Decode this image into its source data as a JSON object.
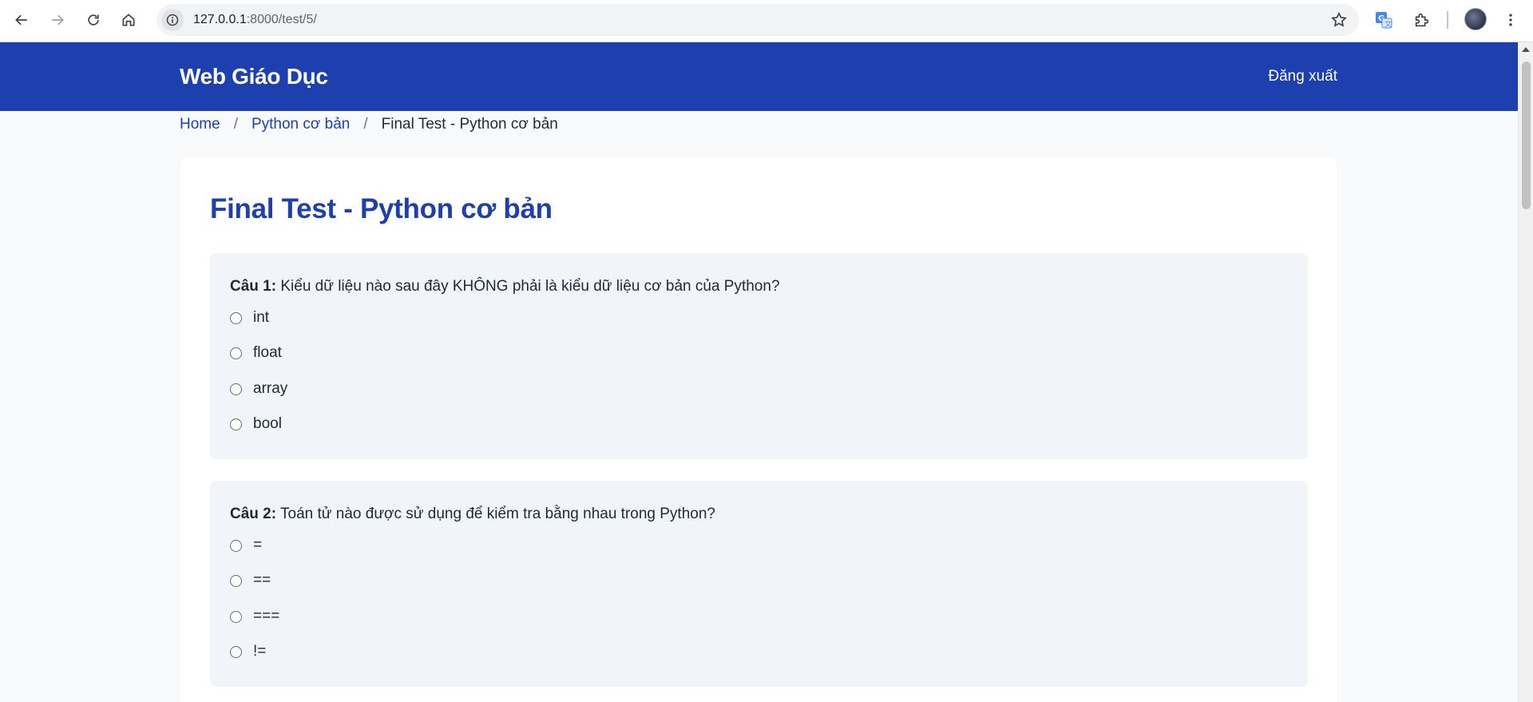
{
  "browser": {
    "url_host": "127.0.0.1",
    "url_rest": ":8000/test/5/"
  },
  "header": {
    "brand": "Web Giáo Dục",
    "logout": "Đăng xuất"
  },
  "breadcrumb": {
    "home": "Home",
    "course": "Python cơ bản",
    "current": "Final Test - Python cơ bản",
    "separator": "/"
  },
  "test": {
    "title": "Final Test - Python cơ bản",
    "questions": [
      {
        "label": "Câu 1:",
        "text": " Kiểu dữ liệu nào sau đây KHÔNG phải là kiểu dữ liệu cơ bản của Python?",
        "options": [
          "int",
          "float",
          "array",
          "bool"
        ]
      },
      {
        "label": "Câu 2:",
        "text": " Toán tử nào được sử dụng để kiểm tra bằng nhau trong Python?",
        "options": [
          "=",
          "==",
          "===",
          "!="
        ]
      }
    ]
  },
  "colors": {
    "primary": "#1e40af",
    "question_bg": "#f1f4f9",
    "page_bg": "#f8fafc"
  }
}
